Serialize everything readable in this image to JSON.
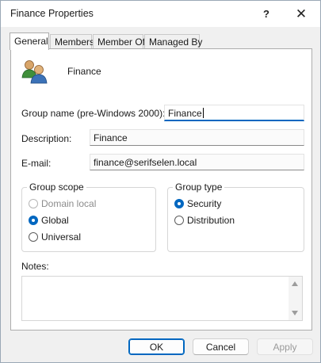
{
  "window": {
    "title": "Finance Properties",
    "help_glyph": "?",
    "close_glyph": "✕"
  },
  "tabs": [
    {
      "label": "General",
      "active": true
    },
    {
      "label": "Members",
      "active": false
    },
    {
      "label": "Member Of",
      "active": false
    },
    {
      "label": "Managed By",
      "active": false
    }
  ],
  "general": {
    "group_name_display": "Finance",
    "group_name_pre2000_label": "Group name (pre-Windows 2000):",
    "group_name_pre2000_value": "Finance",
    "description_label": "Description:",
    "description_value": "Finance",
    "email_label": "E-mail:",
    "email_value": "finance@serifselen.local",
    "group_scope": {
      "title": "Group scope",
      "options": [
        {
          "label": "Domain local",
          "checked": false,
          "disabled": true
        },
        {
          "label": "Global",
          "checked": true,
          "disabled": false
        },
        {
          "label": "Universal",
          "checked": false,
          "disabled": false
        }
      ]
    },
    "group_type": {
      "title": "Group type",
      "options": [
        {
          "label": "Security",
          "checked": true
        },
        {
          "label": "Distribution",
          "checked": false
        }
      ]
    },
    "notes_label": "Notes:",
    "notes_value": ""
  },
  "buttons": {
    "ok": "OK",
    "cancel": "Cancel",
    "apply": "Apply"
  },
  "colors": {
    "accent": "#0067c0"
  }
}
